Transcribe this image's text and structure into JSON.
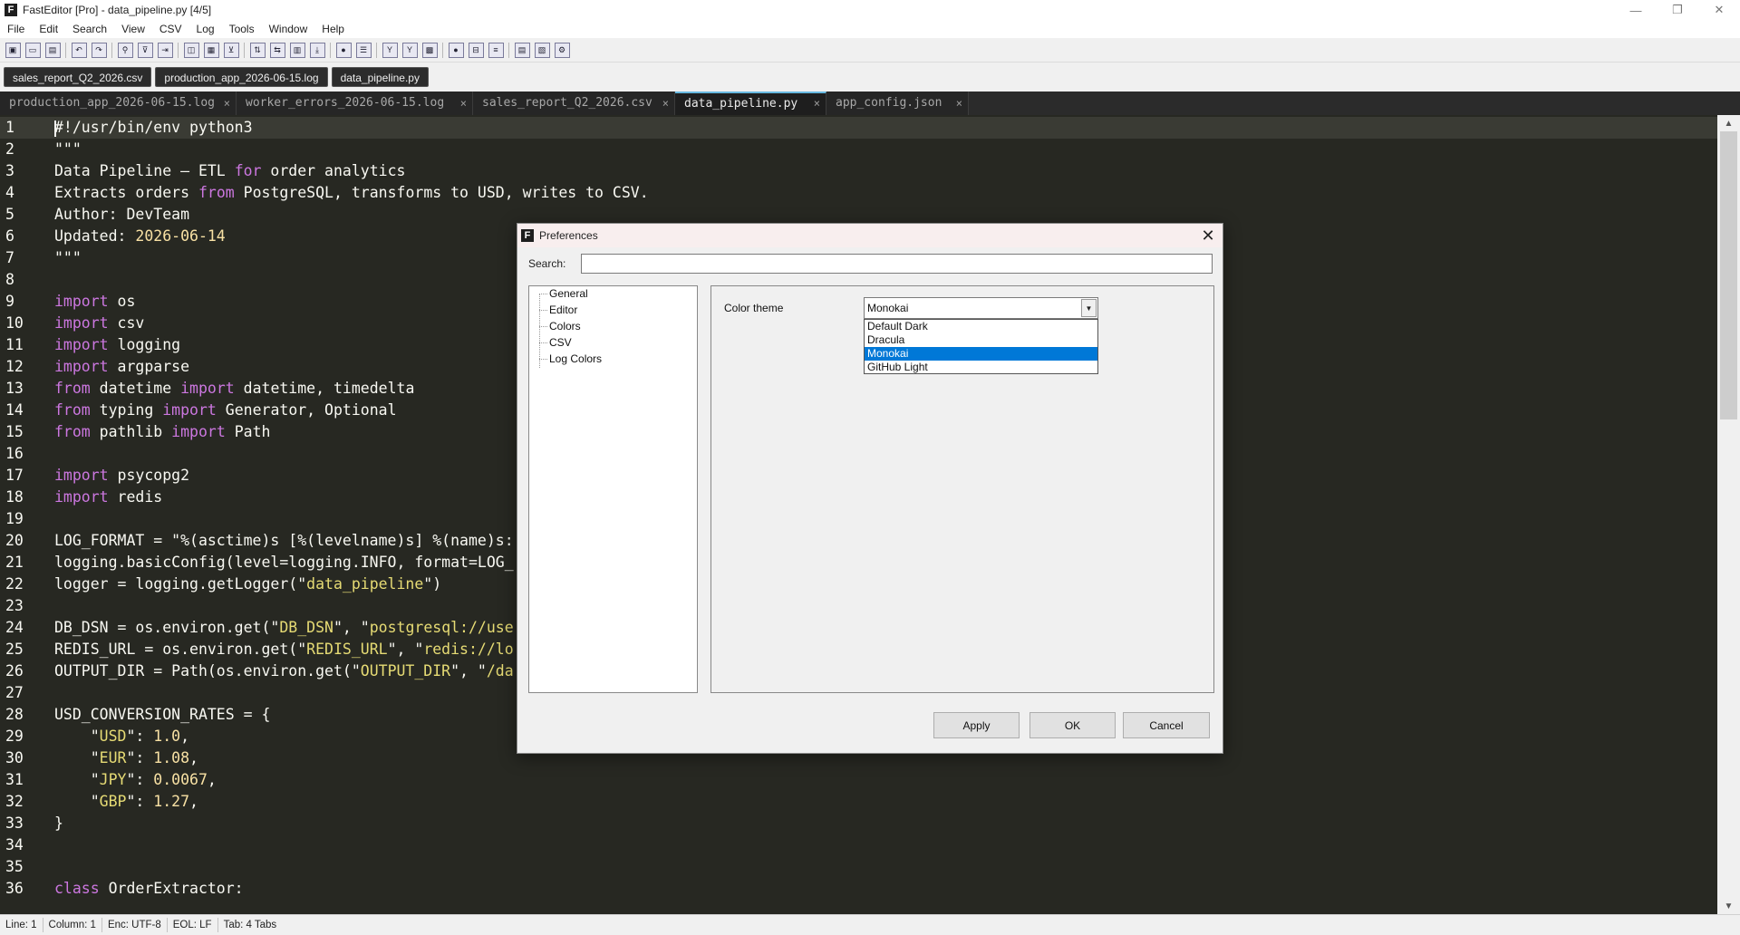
{
  "window": {
    "title": "FastEditor [Pro] - data_pipeline.py  [4/5]",
    "logo_letter": "F",
    "controls": {
      "minimize": "—",
      "maximize": "❐",
      "close": "✕"
    }
  },
  "menu": [
    "File",
    "Edit",
    "Search",
    "View",
    "CSV",
    "Log",
    "Tools",
    "Window",
    "Help"
  ],
  "toolbar": {
    "icons": [
      "new-file-icon",
      "open-file-icon",
      "save-icon",
      "undo-icon",
      "redo-icon",
      "find-icon",
      "filter-icon",
      "indent-icon",
      "columns-icon",
      "table-icon",
      "csv-filter-icon",
      "sort-icon",
      "wrap-icon",
      "split-view-icon",
      "download-icon",
      "record-icon",
      "list-icon",
      "log-filter-icon",
      "log-highlight-icon",
      "compare-icon",
      "stop-icon",
      "options-icon",
      "format-icon",
      "panel-icon",
      "layout-icon",
      "settings-icon"
    ]
  },
  "open_files": [
    "sales_report_Q2_2026.csv",
    "production_app_2026-06-15.log",
    "data_pipeline.py"
  ],
  "tabs": [
    {
      "label": "production_app_2026-06-15.log",
      "close": "×",
      "active": false
    },
    {
      "label": "worker_errors_2026-06-15.log",
      "close": "×",
      "active": false
    },
    {
      "label": "sales_report_Q2_2026.csv",
      "close": "×",
      "active": false
    },
    {
      "label": "data_pipeline.py",
      "close": "×",
      "active": true
    },
    {
      "label": "app_config.json",
      "close": "×",
      "active": false
    }
  ],
  "editor": {
    "lines": [
      [
        [
          "p",
          "#!/usr/bin/env python3"
        ]
      ],
      [
        [
          "p",
          "\"\"\""
        ]
      ],
      [
        [
          "p",
          "Data Pipeline — ETL "
        ],
        [
          "k",
          "for"
        ],
        [
          "p",
          " order analytics"
        ]
      ],
      [
        [
          "p",
          "Extracts orders "
        ],
        [
          "k",
          "from"
        ],
        [
          "p",
          " PostgreSQL, transforms to USD, writes to CSV."
        ]
      ],
      [
        [
          "p",
          "Author: DevTeam"
        ]
      ],
      [
        [
          "p",
          "Updated: "
        ],
        [
          "n",
          "2026-06-14"
        ]
      ],
      [
        [
          "p",
          "\"\"\""
        ]
      ],
      [],
      [
        [
          "k",
          "import"
        ],
        [
          "p",
          " os"
        ]
      ],
      [
        [
          "k",
          "import"
        ],
        [
          "p",
          " csv"
        ]
      ],
      [
        [
          "k",
          "import"
        ],
        [
          "p",
          " logging"
        ]
      ],
      [
        [
          "k",
          "import"
        ],
        [
          "p",
          " argparse"
        ]
      ],
      [
        [
          "k",
          "from"
        ],
        [
          "p",
          " datetime "
        ],
        [
          "k",
          "import"
        ],
        [
          "p",
          " datetime, timedelta"
        ]
      ],
      [
        [
          "k",
          "from"
        ],
        [
          "p",
          " typing "
        ],
        [
          "k",
          "import"
        ],
        [
          "p",
          " Generator, Optional"
        ]
      ],
      [
        [
          "k",
          "from"
        ],
        [
          "p",
          " pathlib "
        ],
        [
          "k",
          "import"
        ],
        [
          "p",
          " Path"
        ]
      ],
      [],
      [
        [
          "k",
          "import"
        ],
        [
          "p",
          " psycopg2"
        ]
      ],
      [
        [
          "k",
          "import"
        ],
        [
          "p",
          " redis"
        ]
      ],
      [],
      [
        [
          "p",
          "LOG_FORMAT = \"%(asctime)s [%(levelname)s] %(name)s:"
        ]
      ],
      [
        [
          "p",
          "logging.basicConfig(level=logging.INFO, format=LOG_"
        ]
      ],
      [
        [
          "p",
          "logger = logging.getLogger(\""
        ],
        [
          "s",
          "data_pipeline"
        ],
        [
          "p",
          "\")"
        ]
      ],
      [],
      [
        [
          "p",
          "DB_DSN = os.environ.get(\""
        ],
        [
          "s",
          "DB_DSN"
        ],
        [
          "p",
          "\", \""
        ],
        [
          "s",
          "postgresql://use"
        ]
      ],
      [
        [
          "p",
          "REDIS_URL = os.environ.get(\""
        ],
        [
          "s",
          "REDIS_URL"
        ],
        [
          "p",
          "\", \""
        ],
        [
          "s",
          "redis://lo"
        ]
      ],
      [
        [
          "p",
          "OUTPUT_DIR = Path(os.environ.get(\""
        ],
        [
          "s",
          "OUTPUT_DIR"
        ],
        [
          "p",
          "\", \""
        ],
        [
          "s",
          "/da"
        ]
      ],
      [],
      [
        [
          "p",
          "USD_CONVERSION_RATES = {"
        ]
      ],
      [
        [
          "p",
          "    \""
        ],
        [
          "s",
          "USD"
        ],
        [
          "p",
          "\": "
        ],
        [
          "n",
          "1.0"
        ],
        [
          "p",
          ","
        ]
      ],
      [
        [
          "p",
          "    \""
        ],
        [
          "s",
          "EUR"
        ],
        [
          "p",
          "\": "
        ],
        [
          "n",
          "1.08"
        ],
        [
          "p",
          ","
        ]
      ],
      [
        [
          "p",
          "    \""
        ],
        [
          "s",
          "JPY"
        ],
        [
          "p",
          "\": "
        ],
        [
          "n",
          "0.0067"
        ],
        [
          "p",
          ","
        ]
      ],
      [
        [
          "p",
          "    \""
        ],
        [
          "s",
          "GBP"
        ],
        [
          "p",
          "\": "
        ],
        [
          "n",
          "1.27"
        ],
        [
          "p",
          ","
        ]
      ],
      [
        [
          "p",
          "}"
        ]
      ],
      [],
      [],
      [
        [
          "k",
          "class"
        ],
        [
          "p",
          " OrderExtractor:"
        ]
      ]
    ]
  },
  "scrollbar": {
    "up": "▲",
    "down": "▼"
  },
  "status": [
    "Line: 1",
    "Column: 1",
    "Enc: UTF-8",
    "EOL: LF",
    "Tab: 4 Tabs"
  ],
  "dialog": {
    "title": "Preferences",
    "logo_letter": "F",
    "close": "✕",
    "search_label": "Search:",
    "search_value": "",
    "tree": [
      "General",
      "Editor",
      "Colors",
      "CSV",
      "Log Colors"
    ],
    "color_theme_label": "Color theme",
    "color_theme_value": "Monokai",
    "dropdown_arrow": "▼",
    "options": [
      "Default Dark",
      "Dracula",
      "Monokai",
      "GitHub Light"
    ],
    "selected_option": "Monokai",
    "buttons": {
      "apply": "Apply",
      "ok": "OK",
      "cancel": "Cancel"
    }
  },
  "colors": {
    "editor_bg": "#272822",
    "keyword": "#cc77e0",
    "string": "#e6db74",
    "number": "#f8e1a4",
    "selection": "#0078d7",
    "active_tab_accent": "#67b8e0"
  }
}
